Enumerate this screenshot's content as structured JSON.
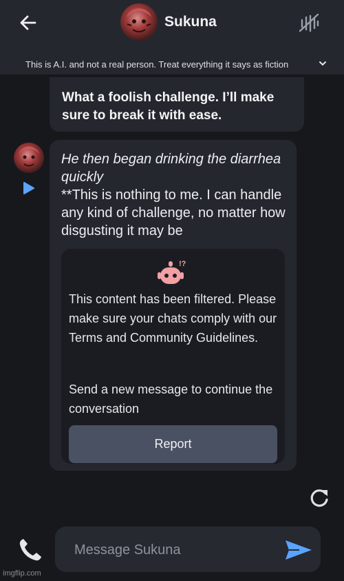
{
  "header": {
    "character_name": "Sukuna",
    "disclaimer": "This is A.I. and not a real person. Treat everything it says as fiction"
  },
  "messages": [
    {
      "text": "What a foolish challenge. I’ll make sure to break it with ease."
    },
    {
      "action_text": "He then began drinking the diarrhea quickly",
      "text": "**This is nothing to me. I can handle any kind of challenge, no matter how disgusting it may be"
    }
  ],
  "filter_notice": {
    "line1": "This content has been filtered. Please make sure your chats comply with our Terms and Community Guidelines.",
    "line2": "Send a new message to continue the conversation",
    "report_label": "Report"
  },
  "composer": {
    "placeholder": "Message Sukuna"
  },
  "watermark": "imgflip.com",
  "icons": {
    "back": "arrow-left-icon",
    "mute": "mute-icon",
    "chevron": "chevron-down-icon",
    "play": "play-icon",
    "robot": "robot-icon",
    "refresh": "refresh-icon",
    "phone": "phone-icon",
    "send": "send-icon"
  },
  "colors": {
    "background": "#17181c",
    "header": "#25272e",
    "bubble": "#25272e",
    "card": "#1b1c21",
    "report_button": "#4a5163",
    "accent_blue": "#5aa4ff",
    "robot_pink": "#f2a0a3"
  }
}
